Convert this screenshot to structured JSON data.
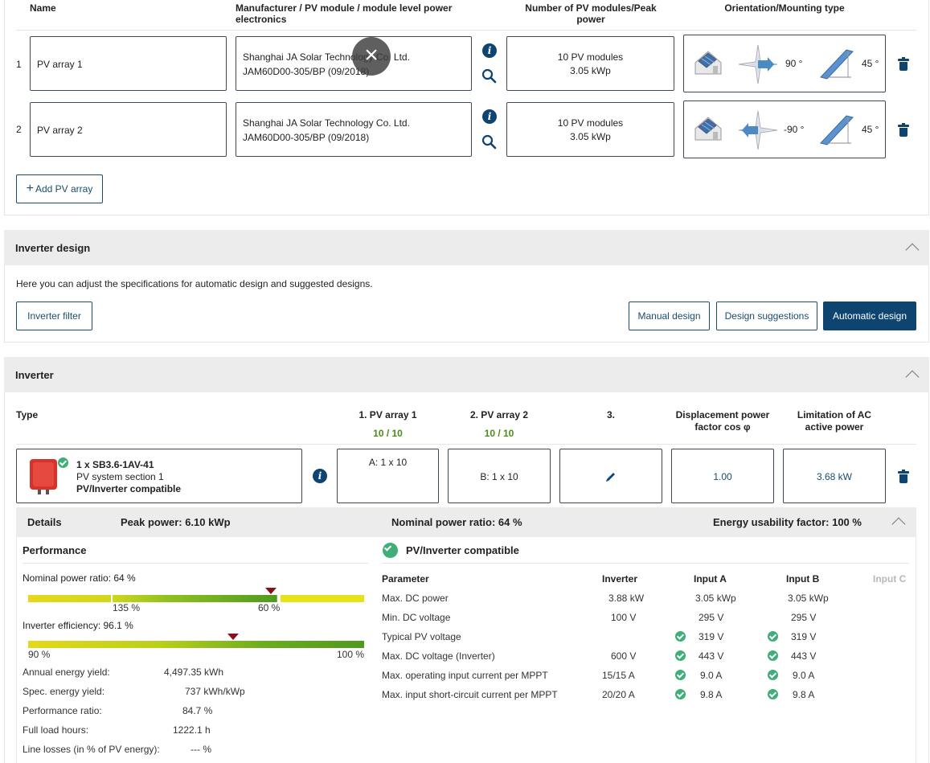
{
  "pv_arrays": {
    "headers": {
      "name": "Name",
      "manufacturer": "Manufacturer / PV module / module level power electronics",
      "modules": "Number of PV modules/Peak power",
      "orientation": "Orientation/Mounting type"
    },
    "rows": [
      {
        "index": "1",
        "name": "PV array 1",
        "manufacturer": "Shanghai JA Solar Technology Co. Ltd.",
        "module": "JAM60D00-305/BP (09/2018)",
        "count": "10 PV modules",
        "peak": "3.05 kWp",
        "azimuth": "90 °",
        "tilt": "45 °"
      },
      {
        "index": "2",
        "name": "PV array 2",
        "manufacturer": "Shanghai JA Solar Technology Co. Ltd.",
        "module": "JAM60D00-305/BP (09/2018)",
        "count": "10 PV modules",
        "peak": "3.05 kWp",
        "azimuth": "-90 °",
        "tilt": "45 °"
      }
    ],
    "add_button": "Add PV array",
    "add_icon": "+",
    "overlay_close": "×"
  },
  "inverter_design": {
    "title": "Inverter design",
    "description": "Here you can adjust the specifications for automatic design and suggested designs.",
    "filter_button": "Inverter filter",
    "manual_button": "Manual design",
    "suggestions_button": "Design suggestions",
    "automatic_button": "Automatic design"
  },
  "inverter": {
    "title": "Inverter",
    "headers": {
      "type": "Type",
      "array1": "1. PV array 1",
      "array1_count": "10 / 10",
      "array2": "2. PV array 2",
      "array2_count": "10 / 10",
      "array3": "3.",
      "cos_phi": "Displacement power factor cos φ",
      "limitation": "Limitation of AC active power"
    },
    "device": {
      "model": "1 x SB3.6-1AV-41",
      "section": "PV system section 1",
      "compat": "PV/Inverter compatible"
    },
    "input_a": "A: 1 x 10",
    "input_b": "B: 1 x 10",
    "cos_phi_value": "1.00",
    "limit_value": "3.68 kW",
    "details": {
      "label": "Details",
      "peak": "Peak power: 6.10 kWp",
      "nominal": "Nominal power ratio: 64 %",
      "energy": "Energy usability factor: 100 %"
    },
    "performance": {
      "title": "Performance",
      "nominal_label": "Nominal power ratio: 64 %",
      "nominal_bar": {
        "tick_left": "135 %",
        "tick_right": "60 %",
        "marker_fraction": 0.72
      },
      "efficiency_label": "Inverter efficiency: 96.1 %",
      "efficiency_bar": {
        "min": "90 %",
        "max": "100 %",
        "marker_fraction": 0.61
      },
      "stats": [
        {
          "label": "Annual energy yield:",
          "value": "4,497.35 kWh"
        },
        {
          "label": "Spec. energy yield:",
          "value": "737 kWh/kWp"
        },
        {
          "label": "Performance ratio:",
          "value": "84.7 %"
        },
        {
          "label": "Full load hours:",
          "value": "1222.1 h"
        },
        {
          "label": "Line losses (in % of PV energy):",
          "value": "--- %"
        }
      ]
    },
    "compat": {
      "title": "PV/Inverter compatible",
      "columns": [
        "Parameter",
        "Inverter",
        "Input A",
        "Input B",
        "Input C"
      ],
      "rows": [
        {
          "param": "Max. DC power",
          "inv": "3.88 kW",
          "a": "3.05 kWp",
          "b": "3.05 kWp",
          "check": false
        },
        {
          "param": "Min. DC voltage",
          "inv": "100 V",
          "a": "295 V",
          "b": "295 V",
          "check": false
        },
        {
          "param": "Typical PV voltage",
          "inv": "",
          "a": "319 V",
          "b": "319 V",
          "check": true
        },
        {
          "param": "Max. DC voltage (Inverter)",
          "inv": "600 V",
          "a": "443 V",
          "b": "443 V",
          "check": true
        },
        {
          "param": "Max. operating input current per MPPT",
          "inv": "15/15 A",
          "a": "9.0 A",
          "b": "9.0 A",
          "check": true
        },
        {
          "param": "Max. input short-circuit current per MPPT",
          "inv": "20/20 A",
          "a": "9.8 A",
          "b": "9.8 A",
          "check": true
        }
      ]
    }
  },
  "colors": {
    "primary": "#0e4470",
    "ok": "#3fae7a",
    "count": "#4c8c1c",
    "marker": "#8b0f1a"
  }
}
